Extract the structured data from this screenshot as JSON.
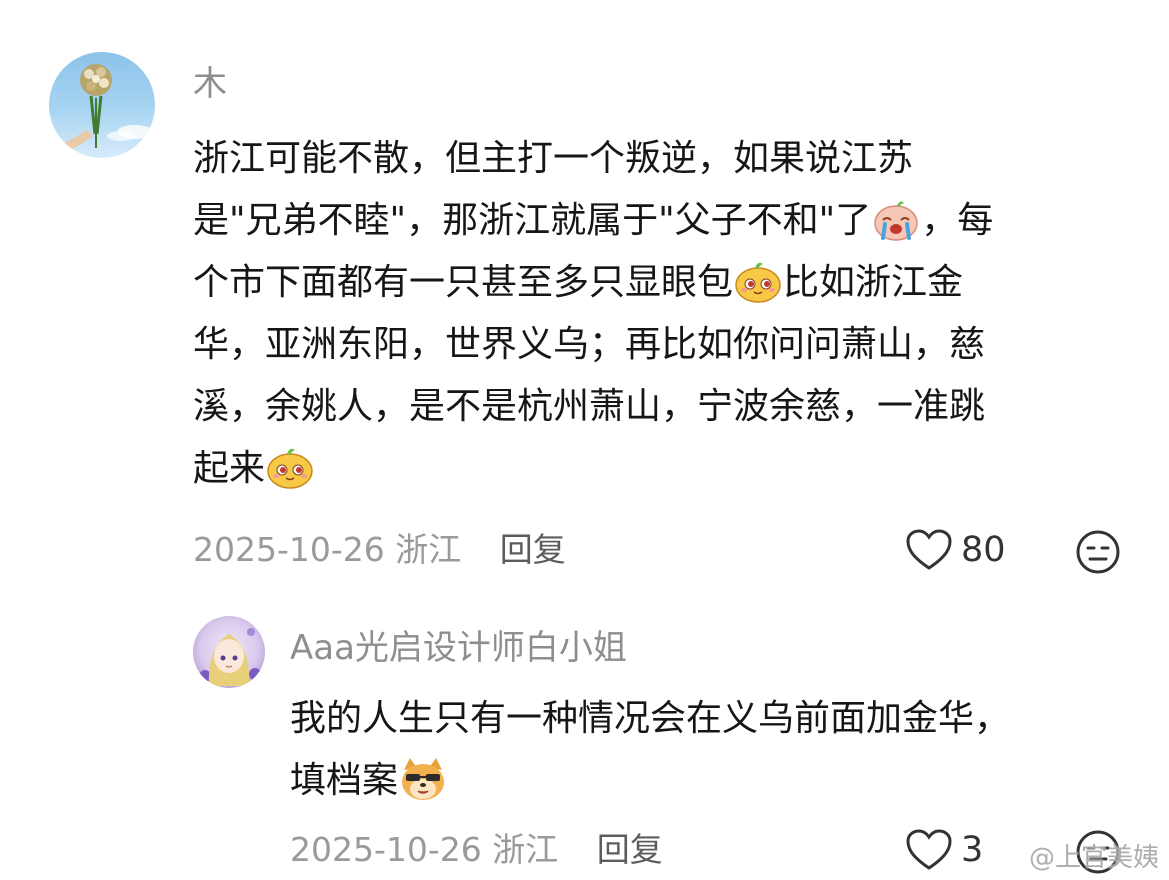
{
  "comment": {
    "username": "木",
    "lines": [
      "浙江可能不散，但主打一个叛逆，如果说江苏",
      "是\"兄弟不睦\"，那浙江就属于\"父子不和\"了",
      "，每",
      "个市下面都有一只甚至多只显眼包",
      "比如浙江金",
      "华，亚洲东阳，世界义乌；再比如你问问萧山，慈",
      "溪，余姚人，是不是杭州萧山，宁波余慈，一准跳",
      "起来"
    ],
    "date": "2025-10-26",
    "location": "浙江",
    "reply_label": "回复",
    "like_count": "80"
  },
  "reply": {
    "username": "Aaa光启设计师白小姐",
    "lines": [
      "我的人生只有一种情况会在义乌前面加金华，",
      "填档案"
    ],
    "date": "2025-10-26",
    "location": "浙江",
    "reply_label": "回复",
    "like_count": "3"
  },
  "watermark": "@上官美姨",
  "icons": {
    "heart": "heart-outline-icon",
    "dislike": "neutral-face-icon",
    "emoji_cry": "crying-face-emoji",
    "emoji_smug": "smug-bun-emoji",
    "emoji_dog": "sunglasses-dog-emoji"
  },
  "colors": {
    "text": "#161616",
    "username": "#8e8e8e",
    "meta": "#9a9a9a",
    "reply_button": "#5c5c5c",
    "background": "#ffffff"
  }
}
